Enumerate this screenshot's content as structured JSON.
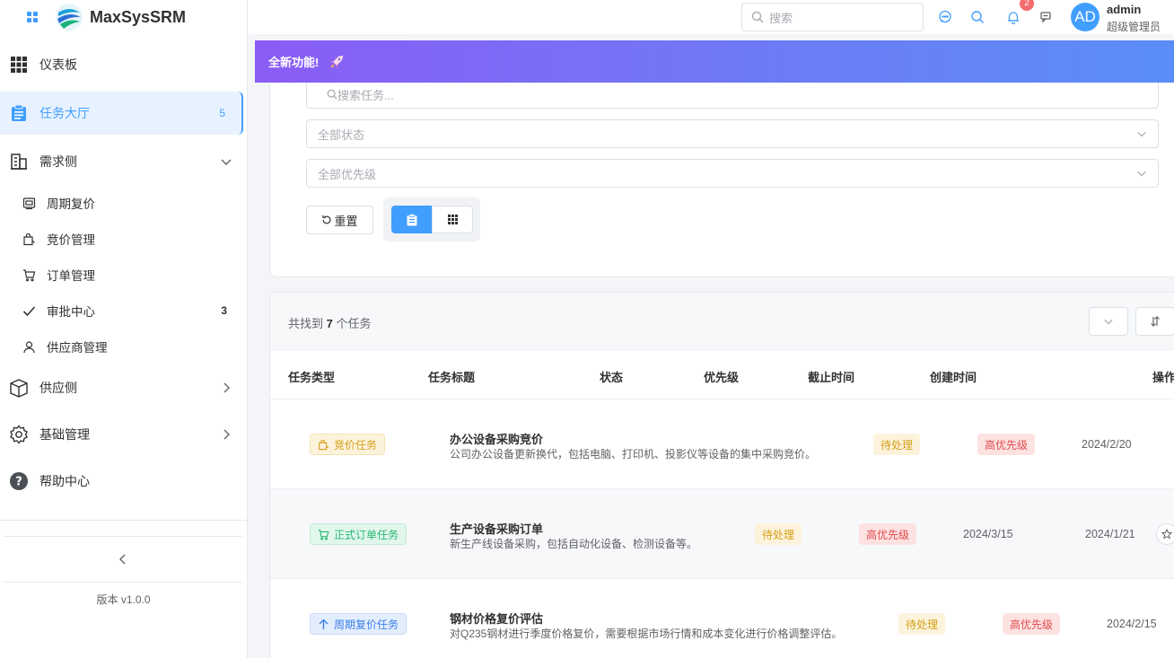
{
  "app": {
    "name": "MaxSysSRM"
  },
  "sidebar": {
    "items": [
      {
        "label": "仪表板"
      },
      {
        "label": "任务大厅",
        "badge": "5"
      },
      {
        "label": "需求侧"
      },
      {
        "label": "供应侧"
      },
      {
        "label": "基础管理"
      },
      {
        "label": "帮助中心"
      }
    ],
    "demand_sub": [
      {
        "label": "周期复价"
      },
      {
        "label": "竞价管理"
      },
      {
        "label": "订单管理"
      },
      {
        "label": "审批中心",
        "badge": "3"
      },
      {
        "label": "供应商管理"
      }
    ],
    "version": "版本 v1.0.0"
  },
  "header": {
    "search_placeholder": "搜索",
    "notifications": "2",
    "avatar": "AD",
    "username": "admin",
    "role": "超级管理员"
  },
  "banner": {
    "text": "全新功能!"
  },
  "filters": {
    "search_placeholder": "搜索任务...",
    "status": "全部状态",
    "priority": "全部优先级",
    "reset": "重置"
  },
  "results": {
    "count_prefix": "共找到",
    "count": "7",
    "count_suffix": "个任务",
    "columns": [
      "任务类型",
      "任务标题",
      "状态",
      "优先级",
      "截止时间",
      "创建时间",
      "操作"
    ],
    "rows": [
      {
        "type": "竞价任务",
        "title": "办公设备采购竞价",
        "desc": "公司办公设备更新换代，包括电脑、打印机、投影仪等设备的集中采购竞价。",
        "status": "待处理",
        "priority": "高优先级",
        "deadline": "",
        "created": "2024/2/20"
      },
      {
        "type": "正式订单任务",
        "title": "生产设备采购订单",
        "desc": "新生产线设备采购，包括自动化设备、检测设备等。",
        "status": "待处理",
        "priority": "高优先级",
        "deadline": "2024/3/15",
        "created": "2024/1/21"
      },
      {
        "type": "周期复价任务",
        "title": "钢材价格复价评估",
        "desc": "对Q235钢材进行季度价格复价，需要根据市场行情和成本变化进行价格调整评估。",
        "status": "待处理",
        "priority": "高优先级",
        "deadline": "",
        "created": "2024/2/15"
      }
    ]
  },
  "colors": {
    "accent": "#409eff",
    "banner_start": "#8b5cf6",
    "banner_end": "#5b8df6"
  }
}
